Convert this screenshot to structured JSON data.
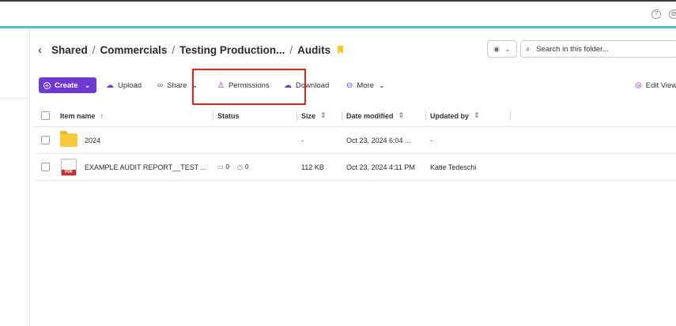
{
  "topbar": {
    "icons": [
      "help-icon",
      "settings-icon"
    ]
  },
  "breadcrumb": {
    "items": [
      "Shared",
      "Commercials",
      "Testing Production...",
      "Audits"
    ],
    "separator": "/"
  },
  "view_select": {
    "icon": "view-icon"
  },
  "search": {
    "placeholder": "Search in this folder..."
  },
  "toolbar": {
    "create_label": "Create",
    "upload_label": "Upload",
    "share_label": "Share",
    "permissions_label": "Permissions",
    "download_label": "Download",
    "more_label": "More",
    "edit_view_label": "Edit View"
  },
  "table": {
    "columns": {
      "name": "Item name",
      "status": "Status",
      "size": "Size",
      "date": "Date modified",
      "updated_by": "Updated by"
    },
    "rows": [
      {
        "type": "folder",
        "name": "2024",
        "status": "",
        "size": "-",
        "date": "Oct 23, 2024 6:04 ...",
        "updated_by": "-"
      },
      {
        "type": "pdf",
        "name": "EXAMPLE AUDIT REPORT__TEST ...",
        "comments": "0",
        "versions": "0",
        "size": "112 KB",
        "date": "Oct 23, 2024 4:11 PM",
        "updated_by": "Katie Tedeschi",
        "badge": "PDF"
      }
    ]
  },
  "colors": {
    "accent": "#6f3ad1",
    "highlight": "#e5221a",
    "topbar_line": "#4fc3c3",
    "bookmark": "#f6c61c"
  }
}
